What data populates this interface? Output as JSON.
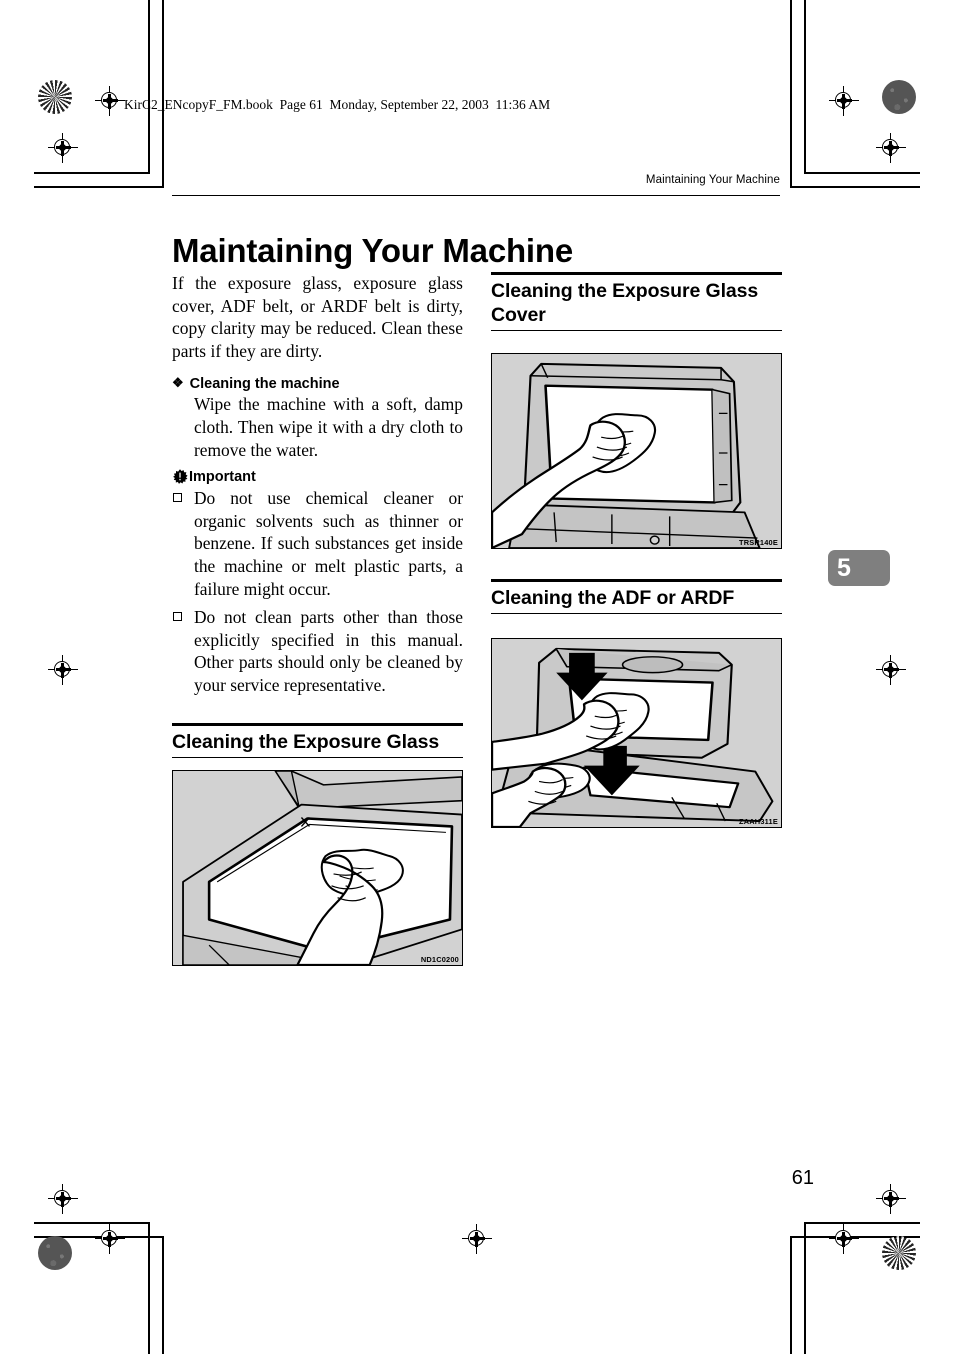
{
  "printing": {
    "book_header": "KirC2_ENcopyF_FM.book  Page 61  Monday, September 22, 2003  11:36 AM"
  },
  "page": {
    "running_head": "Maintaining Your Machine",
    "chapter_title": "Maintaining Your Machine",
    "chapter_tab": "5",
    "page_number": "61"
  },
  "left_column": {
    "intro": "If the exposure glass, exposure glass cover, ADF belt, or ARDF belt is dirty, copy clarity may be reduced. Clean these parts if they are dirty.",
    "keyword_block": {
      "bullet": "❖",
      "title": "Cleaning the machine",
      "body": "Wipe the machine with a soft, damp cloth. Then wipe it with a dry cloth to remove the water."
    },
    "important": {
      "icon": "gear-exclamation-icon",
      "label": "Important",
      "items": [
        "Do not use chemical cleaner or organic solvents such as thinner or benzene. If such substances get inside the machine or melt plastic parts, a failure might occur.",
        "Do not clean parts other than those explicitly specified in this manual. Other parts should only be cleaned by your service representative."
      ]
    },
    "section": {
      "heading": "Cleaning the Exposure Glass",
      "figure_id": "ND1C0200",
      "figure_alt": "hand-wiping-exposure-glass-illustration"
    }
  },
  "right_column": {
    "section_cover": {
      "heading": "Cleaning the Exposure Glass Cover",
      "figure_id": "TRSR140E",
      "figure_alt": "hand-wiping-exposure-glass-cover-illustration"
    },
    "section_adf": {
      "heading": "Cleaning the ADF or ARDF",
      "figure_id": "ZAAH311E",
      "figure_alt": "two-hands-wiping-adf-belt-illustration"
    }
  },
  "colors": {
    "figure_background": "#d2d2d2",
    "chapter_tab_background": "#7f7f7f",
    "rule": "#000000"
  }
}
